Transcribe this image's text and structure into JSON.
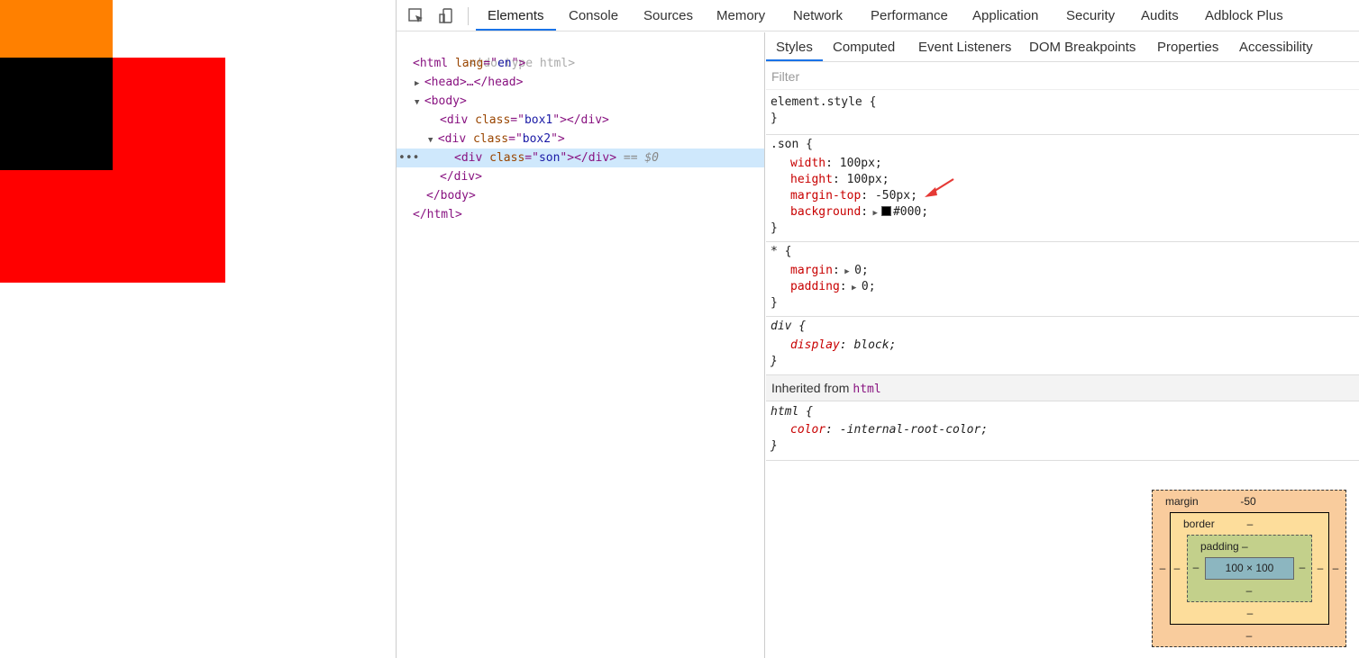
{
  "devtools": {
    "main_tabs": [
      "Elements",
      "Console",
      "Sources",
      "Memory",
      "Network",
      "Performance",
      "Application",
      "Security",
      "Audits",
      "Adblock Plus"
    ],
    "active_main_tab": "Elements",
    "sub_tabs": [
      "Styles",
      "Computed",
      "Event Listeners",
      "DOM Breakpoints",
      "Properties",
      "Accessibility"
    ],
    "active_sub_tab": "Styles",
    "filter_placeholder": "Filter",
    "toolbar_icons": [
      "inspect-element-icon",
      "device-toolbar-icon"
    ]
  },
  "dom": {
    "doctype": "<!doctype html>",
    "html_open": {
      "tag": "html",
      "attr": "lang",
      "val": "en"
    },
    "head": "<head>…</head>",
    "body_open": "<body>",
    "box1": {
      "tag": "div",
      "attr": "class",
      "val": "box1"
    },
    "box2": {
      "tag": "div",
      "attr": "class",
      "val": "box2"
    },
    "son": {
      "tag": "div",
      "attr": "class",
      "val": "son",
      "suffix": "== $0"
    },
    "div_close": "</div>",
    "body_close": "</body>",
    "html_close": "</html>"
  },
  "styles": {
    "element_style": "element.style {",
    "close_brace": "}",
    "son_rule": {
      "selector": ".son {",
      "props": [
        {
          "name": "width",
          "value": "100px;"
        },
        {
          "name": "height",
          "value": "100px;"
        },
        {
          "name": "margin-top",
          "value": "-50px;"
        },
        {
          "name": "background",
          "value": "#000;"
        }
      ]
    },
    "universal_rule": {
      "selector": "* {",
      "props": [
        {
          "name": "margin",
          "value": "0;"
        },
        {
          "name": "padding",
          "value": "0;"
        }
      ]
    },
    "div_rule": {
      "selector": "div {",
      "props": [
        {
          "name": "display",
          "value": "block;"
        }
      ]
    },
    "inherited_label": "Inherited from",
    "inherited_tag": "html",
    "html_rule": {
      "selector": "html {",
      "props": [
        {
          "name": "color",
          "value": "-internal-root-color;"
        }
      ]
    }
  },
  "box_model": {
    "margin_label": "margin",
    "margin_top": "-50",
    "margin_right": "–",
    "margin_bottom": "–",
    "margin_left": "–",
    "border_label": "border",
    "border_top": "–",
    "border_right": "–",
    "border_bottom": "–",
    "border_left": "–",
    "padding_label": "padding –",
    "padding_right": "–",
    "padding_bottom": "–",
    "padding_left": "–",
    "content": "100 × 100"
  },
  "colors": {
    "box1": "#ff8000",
    "box2": "#ff0000",
    "son": "#000000",
    "accent": "#1a73e8",
    "annotation_arrow": "#e53935"
  }
}
